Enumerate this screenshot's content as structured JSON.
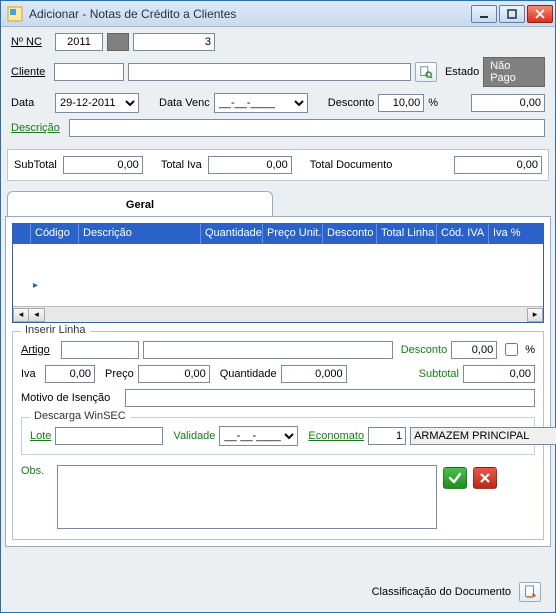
{
  "window": {
    "title": "Adicionar - Notas de Crédito a Clientes"
  },
  "header": {
    "numnc_label": "Nº NC",
    "numnc_year": "2011",
    "numnc_seq": "3",
    "cliente_label": "Cliente",
    "cliente_code": "",
    "cliente_name": "",
    "estado_label": "Estado",
    "estado_value": "Não Pago",
    "data_label": "Data",
    "data_value": "29-12-2011",
    "datavenc_label": "Data Venc",
    "datavenc_value": "__-__-____",
    "desconto_label": "Desconto",
    "desconto_value": "10,00",
    "desconto_unit": "%",
    "desconto_amount": "0,00",
    "descricao_label": "Descrição",
    "descricao_value": ""
  },
  "totals": {
    "subtotal_label": "SubTotal",
    "subtotal_value": "0,00",
    "totaliva_label": "Total Iva",
    "totaliva_value": "0,00",
    "totaldoc_label": "Total Documento",
    "totaldoc_value": "0,00"
  },
  "tabs": {
    "geral": "Geral"
  },
  "grid": {
    "cols": {
      "codigo": "Código",
      "descricao": "Descrição",
      "quantidade": "Quantidade",
      "preco_unit": "Preço Unit.",
      "desconto": "Desconto",
      "total_linha": "Total Linha",
      "cod_iva": "Cód. IVA",
      "iva_pct": "Iva %"
    },
    "rows": []
  },
  "inserir": {
    "legend": "Inserir Linha",
    "artigo_label": "Artigo",
    "artigo_code": "",
    "artigo_desc": "",
    "desconto_label": "Desconto",
    "desconto_value": "0,00",
    "desconto_unit": "%",
    "iva_label": "Iva",
    "iva_value": "0,00",
    "preco_label": "Preço",
    "preco_value": "0,00",
    "quantidade_label": "Quantidade",
    "quantidade_value": "0,000",
    "subtotal_label": "Subtotal",
    "subtotal_value": "0,00",
    "motivo_label": "Motivo de Isenção",
    "motivo_value": ""
  },
  "descarga": {
    "legend": "Descarga WinSEC",
    "lote_label": "Lote",
    "lote_value": "",
    "validade_label": "Validade",
    "validade_value": "__-__-____",
    "economato_label": "Economato",
    "economato_value": "1",
    "armazem_value": "ARMAZEM PRINCIPAL"
  },
  "obs": {
    "label": "Obs.",
    "value": ""
  },
  "footer": {
    "classif_label": "Classificação do Documento"
  },
  "icons": {
    "lookup": "🔍",
    "doc": "📄",
    "check": "✔",
    "cross": "✖"
  }
}
